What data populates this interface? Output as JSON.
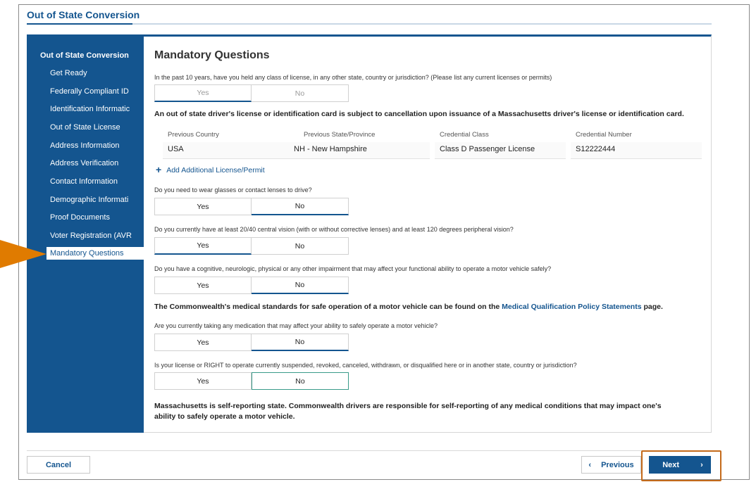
{
  "page_title": "Out of State Conversion",
  "sidebar": {
    "heading": "Out of State Conversion",
    "items": [
      {
        "label": "Get Ready"
      },
      {
        "label": "Federally Compliant ID"
      },
      {
        "label": "Identification Informatic"
      },
      {
        "label": "Out of State License"
      },
      {
        "label": "Address Information"
      },
      {
        "label": "Address Verification"
      },
      {
        "label": "Contact Information"
      },
      {
        "label": "Demographic Informati"
      },
      {
        "label": "Proof Documents"
      },
      {
        "label": "Voter Registration (AVR"
      },
      {
        "label": "Mandatory Questions"
      }
    ],
    "active_index": 10
  },
  "main": {
    "section_title": "Mandatory Questions",
    "q1": "In the past 10 years, have you held any class of license, in any other state, country or jurisdiction? (Please list any current licenses or permits)",
    "cancellation_note": "An out of state driver's license or identification card is subject to cancellation upon issuance of a Massachusetts driver's license or identification card.",
    "credential_headers": [
      "Previous Country",
      "Previous State/Province",
      "Credential Class",
      "Credential Number"
    ],
    "credential_values": [
      "USA",
      "NH - New Hampshire",
      "Class D Passenger License",
      "S12222444"
    ],
    "add_link": "Add Additional License/Permit",
    "q2": "Do you need to wear glasses or contact lenses to drive?",
    "q3": "Do you currently have at least 20/40 central vision (with or without corrective lenses) and at least 120 degrees peripheral vision?",
    "q4": "Do you have a cognitive, neurologic, physical or any other impairment that may affect your functional ability to operate a motor vehicle safely?",
    "medical_note_pre": "The Commonwealth's medical standards for safe operation of a motor vehicle can be found on the ",
    "medical_note_link": "Medical Qualification Policy Statements",
    "medical_note_post": " page.",
    "q5": "Are you currently taking any medication that may affect your ability to safely operate a motor vehicle?",
    "q6": "Is your license or RIGHT to operate currently suspended, revoked, canceled, withdrawn, or disqualified here or in another state, country or jurisdiction?",
    "self_report_line1": "Massachusetts is self-reporting state. Commonwealth drivers are responsible for self-reporting of any medical conditions that may impact one's",
    "self_report_line2": "ability to safely operate a motor vehicle.",
    "yes": "Yes",
    "no": "No"
  },
  "answers": {
    "q1": "Yes",
    "q2": "No",
    "q3": "Yes",
    "q4": "No",
    "q5": "No",
    "q6": "No"
  },
  "footer": {
    "cancel": "Cancel",
    "previous": "Previous",
    "next": "Next"
  },
  "colors": {
    "brand": "#14558f",
    "highlight": "#e07b00",
    "focus": "#3a9b8a"
  }
}
